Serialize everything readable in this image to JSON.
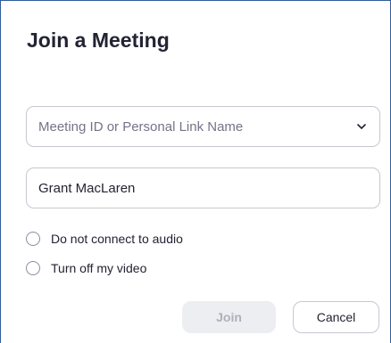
{
  "dialog": {
    "title": "Join a Meeting"
  },
  "meeting_id": {
    "placeholder": "Meeting ID or Personal Link Name",
    "value": "",
    "dropdown_icon": "chevron-down-icon"
  },
  "name_field": {
    "value": "Grant MacLaren"
  },
  "options": {
    "audio_label": "Do not connect to audio",
    "audio_checked": false,
    "video_label": "Turn off my video",
    "video_checked": false
  },
  "buttons": {
    "join_label": "Join",
    "join_enabled": false,
    "cancel_label": "Cancel"
  },
  "colors": {
    "frame_border": "#2f5d9a",
    "text": "#232333",
    "placeholder": "#747487",
    "disabled_button_bg": "#edeef2",
    "disabled_button_text": "#aeb0bb"
  }
}
